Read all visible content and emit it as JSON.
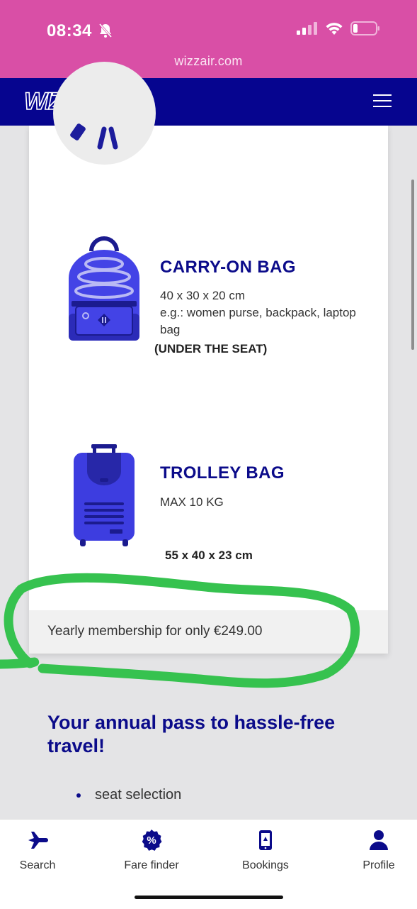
{
  "status_bar": {
    "time": "08:34"
  },
  "browser": {
    "url": "wizzair.com"
  },
  "header": {
    "logo_text": "WIZZ"
  },
  "bags": [
    {
      "title": "CARRY-ON BAG",
      "lines": [
        "40 x 30 x 20 cm",
        "e.g.: women purse, backpack, laptop",
        "bag"
      ],
      "note": "(UNDER THE SEAT)"
    },
    {
      "title": "TROLLEY BAG",
      "lines": [
        "MAX 10 KG"
      ],
      "note": "55 x 40 x 23 cm"
    }
  ],
  "membership": {
    "text": "Yearly membership for only €249.00"
  },
  "section": {
    "headline": "Your annual pass to hassle-free travel!",
    "bullets": [
      "seat selection"
    ]
  },
  "tabs": [
    {
      "label": "Search",
      "icon": "airplane-icon"
    },
    {
      "label": "Fare finder",
      "icon": "percent-badge-icon"
    },
    {
      "label": "Bookings",
      "icon": "phone-ticket-icon"
    },
    {
      "label": "Profile",
      "icon": "person-icon"
    }
  ],
  "colors": {
    "brand_navy": "#06058f",
    "brand_pink": "#d94fa6",
    "bag_blue": "#3d3de0",
    "highlight_green": "#36c24f"
  }
}
